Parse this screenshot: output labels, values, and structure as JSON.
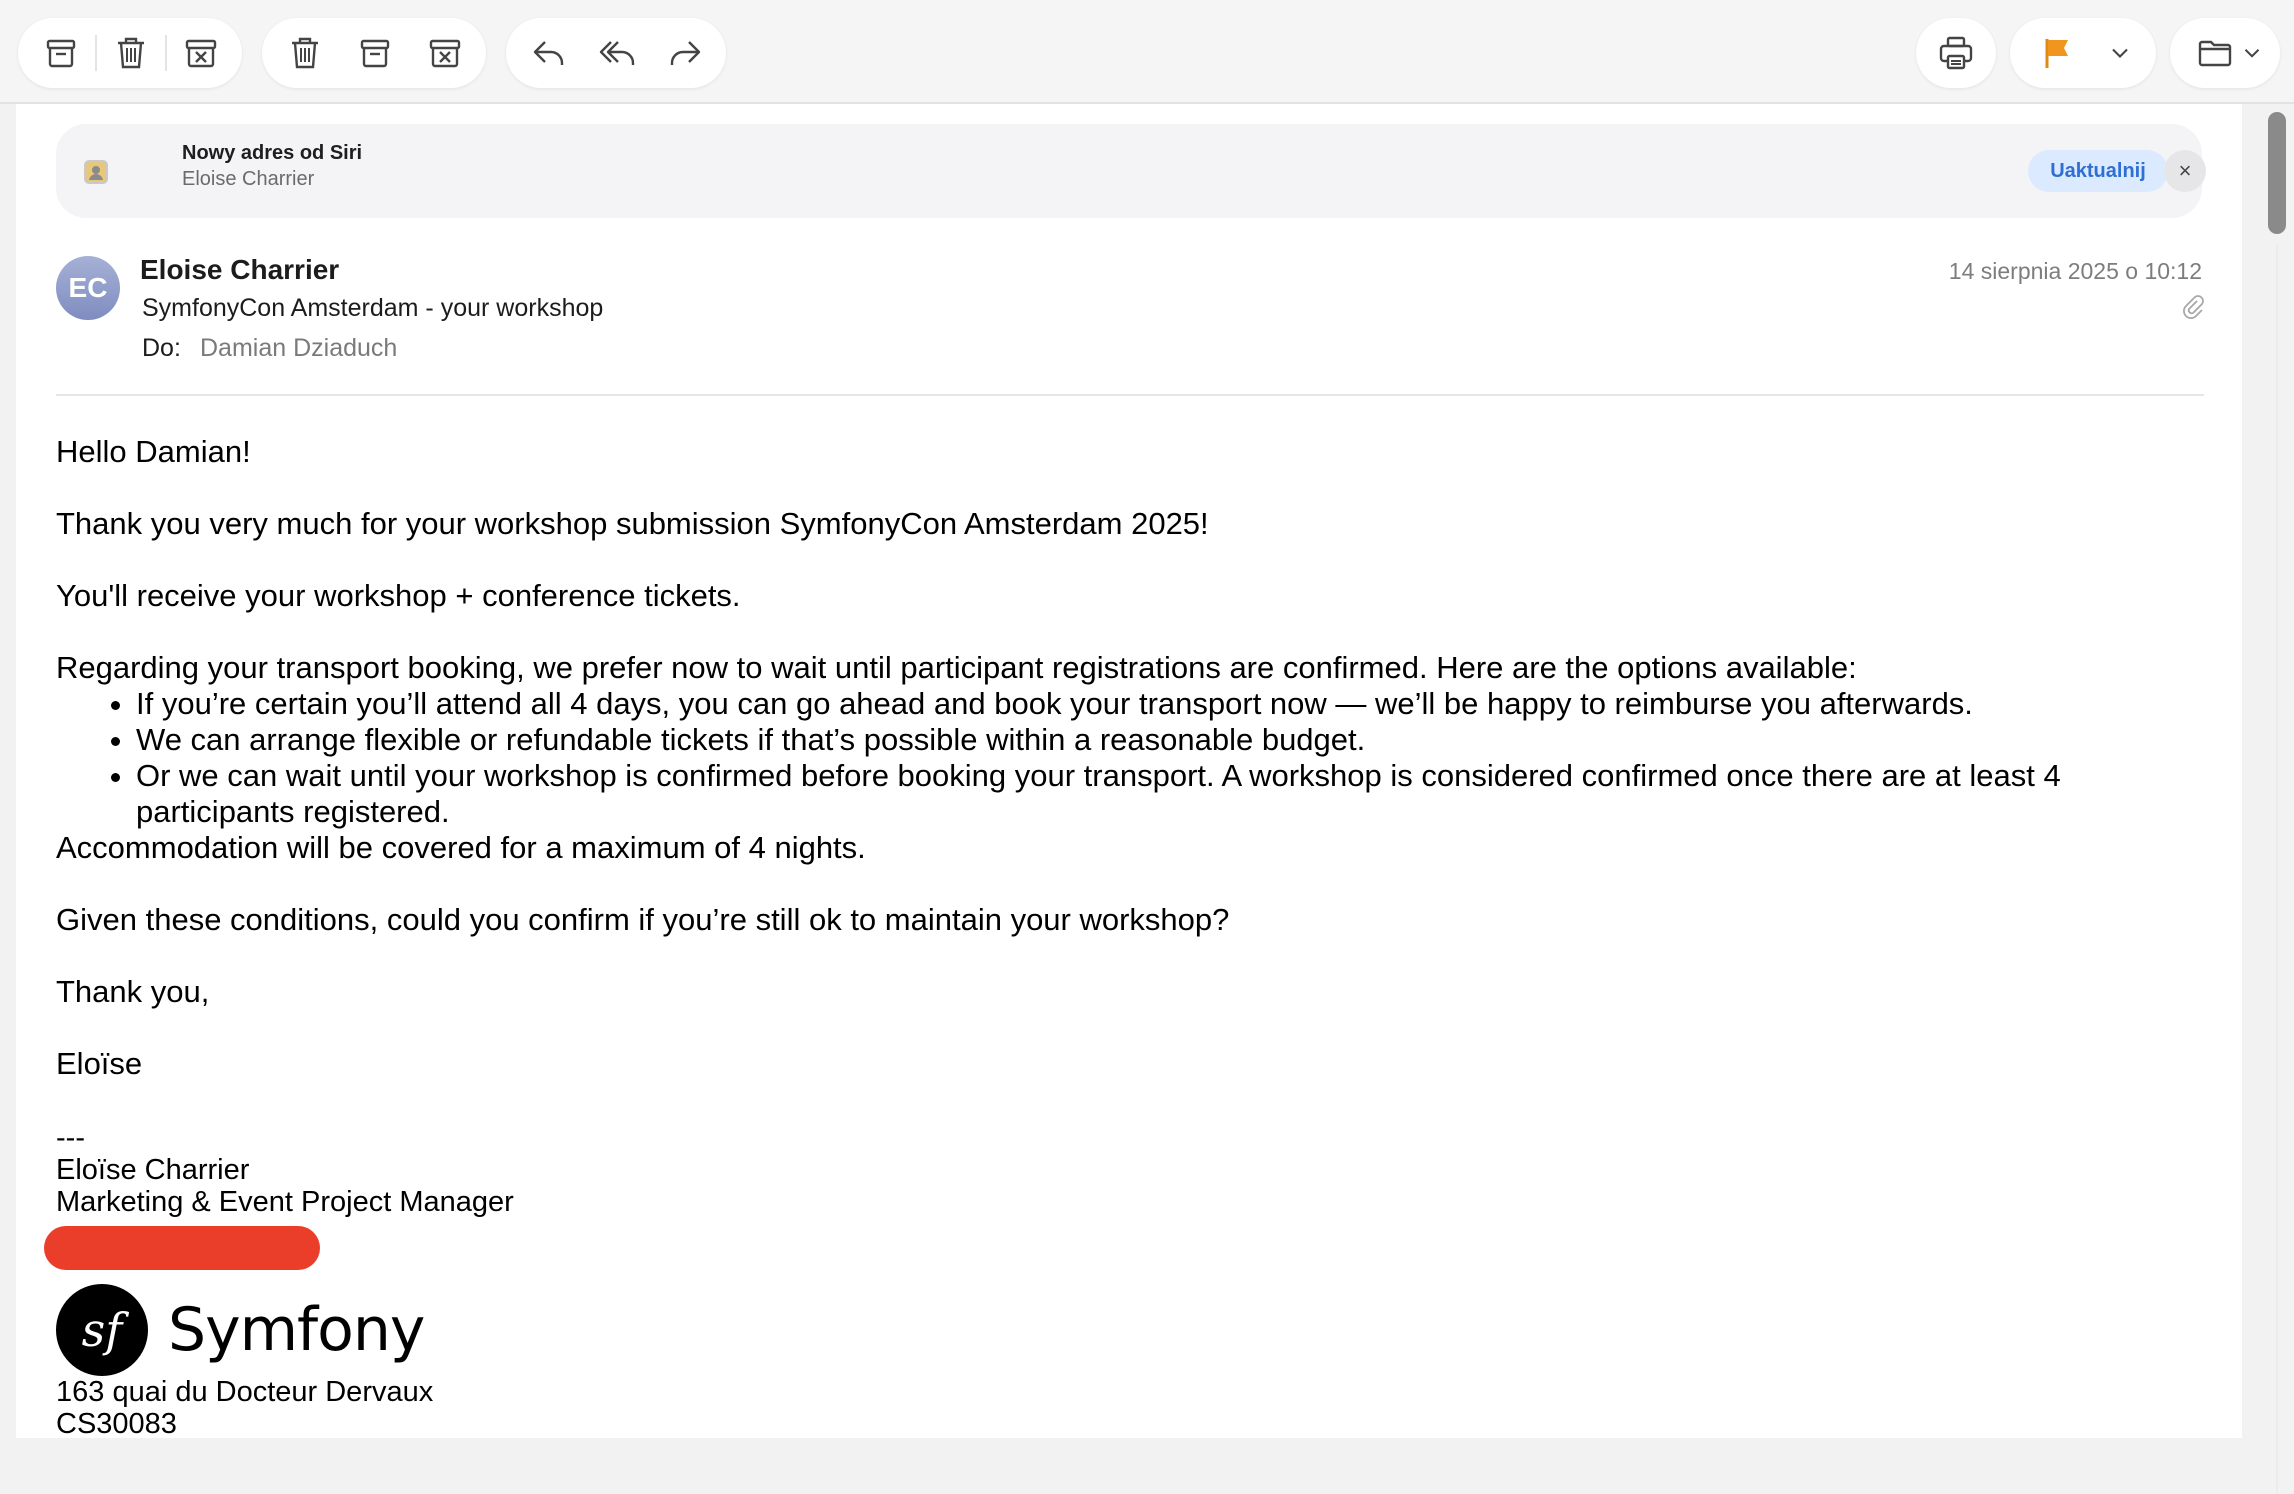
{
  "toolbar": {
    "group1": [
      "archive-icon",
      "trash-icon",
      "junk-icon"
    ],
    "group2": [
      "trash-icon",
      "archive-icon",
      "junk-icon"
    ],
    "group3": [
      "reply-icon",
      "reply-all-icon",
      "forward-icon"
    ],
    "print_icon": "printer-icon",
    "flag_color": "#f0951e",
    "move_icon": "folder-icon"
  },
  "siri_banner": {
    "title": "Nowy adres od Siri",
    "name": "Eloise Charrier",
    "update_label": "Uaktualnij",
    "close_glyph": "×"
  },
  "message": {
    "avatar_initials": "EC",
    "sender": "Eloise Charrier",
    "subject": "SymfonyCon Amsterdam - your workshop",
    "to_label": "Do:",
    "to_value": "Damian Dziaduch",
    "date": "14 sierpnia 2025 o 10:12",
    "has_attachment": true
  },
  "body": {
    "greeting": "Hello Damian!",
    "p1": "Thank you very much for your workshop submission SymfonyCon Amsterdam 2025!",
    "p2": "You'll receive your workshop + conference tickets.",
    "p3": "Regarding your transport booking, we prefer now to wait until participant registrations are confirmed. Here are the options available:",
    "options": [
      "If you’re certain you’ll attend all 4 days, you can go ahead and book your transport now — we’ll be happy to reimburse you afterwards.",
      "We can arrange flexible or refundable tickets if that’s possible within a reasonable budget.",
      "Or we can wait until your workshop is confirmed before booking your transport. A workshop is considered confirmed once there are at least 4 participants registered."
    ],
    "p4": "Accommodation will be covered for a maximum of 4 nights.",
    "p5": "Given these conditions, could you confirm if you’re still ok to maintain your workshop?",
    "thanks": "Thank you,",
    "signoff": "Eloïse"
  },
  "signature": {
    "dashes": "---",
    "name": "Eloïse Charrier",
    "title": "Marketing & Event Project Manager",
    "logo_text": "Symfony",
    "address1": "163 quai du Docteur Dervaux",
    "address2": "CS30083"
  }
}
